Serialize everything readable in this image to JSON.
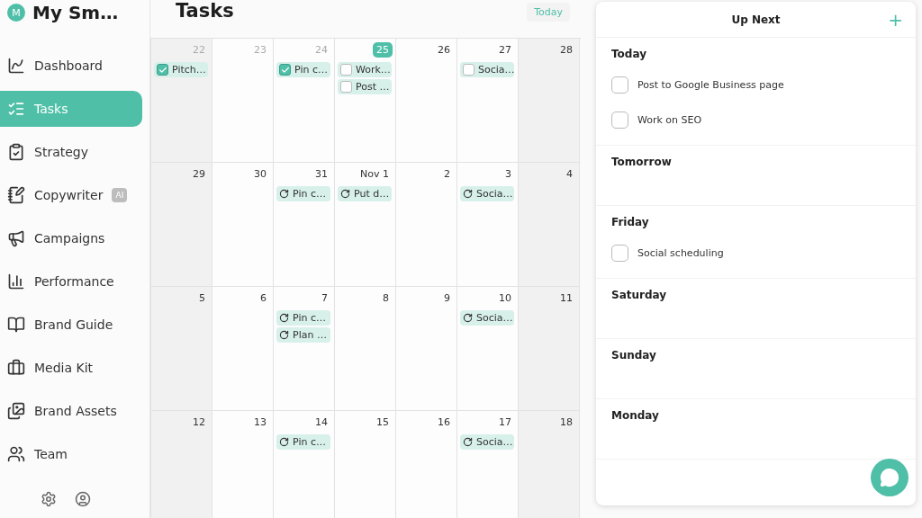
{
  "app": {
    "logo_letter": "M",
    "name": "My Sm…"
  },
  "sidebar": {
    "items": [
      {
        "label": "Dashboard",
        "selected": false
      },
      {
        "label": "Tasks",
        "selected": true
      },
      {
        "label": "Strategy",
        "selected": false
      },
      {
        "label": "Copywriter",
        "selected": false,
        "badge": "AI"
      },
      {
        "label": "Campaigns",
        "selected": false
      },
      {
        "label": "Performance",
        "selected": false
      },
      {
        "label": "Brand Guide",
        "selected": false
      },
      {
        "label": "Media Kit",
        "selected": false
      },
      {
        "label": "Brand Assets",
        "selected": false
      },
      {
        "label": "Team",
        "selected": false
      }
    ]
  },
  "header": {
    "title": "Tasks",
    "today_button": "Today"
  },
  "calendar": {
    "weeks": [
      {
        "days": [
          {
            "label": "22",
            "muted": true,
            "today": false,
            "tasks": [
              {
                "kind": "check",
                "text": "Pitch…",
                "checked": true
              }
            ]
          },
          {
            "label": "23",
            "muted": true,
            "today": false
          },
          {
            "label": "24",
            "muted": true,
            "today": false,
            "tasks": [
              {
                "kind": "check",
                "text": "Pin c…",
                "checked": true
              }
            ]
          },
          {
            "label": "25",
            "muted": false,
            "today": true,
            "tasks": [
              {
                "kind": "check",
                "text": "Work…",
                "checked": false
              },
              {
                "kind": "check",
                "text": "Post …",
                "checked": false
              }
            ]
          },
          {
            "label": "26",
            "muted": false,
            "today": false
          },
          {
            "label": "27",
            "muted": false,
            "today": false,
            "tasks": [
              {
                "kind": "check",
                "text": "Socia…",
                "checked": false
              }
            ]
          },
          {
            "label": "28",
            "muted": false,
            "today": false
          }
        ]
      },
      {
        "days": [
          {
            "label": "29",
            "muted": false,
            "today": false
          },
          {
            "label": "30",
            "muted": false,
            "today": false
          },
          {
            "label": "31",
            "muted": false,
            "today": false,
            "tasks": [
              {
                "kind": "recurring",
                "text": "Pin c…"
              }
            ]
          },
          {
            "label": "Nov 1",
            "muted": false,
            "today": false,
            "tasks": [
              {
                "kind": "recurring",
                "text": "Put d…"
              }
            ]
          },
          {
            "label": "2",
            "muted": false,
            "today": false
          },
          {
            "label": "3",
            "muted": false,
            "today": false,
            "tasks": [
              {
                "kind": "recurring",
                "text": "Socia…"
              }
            ]
          },
          {
            "label": "4",
            "muted": false,
            "today": false
          }
        ]
      },
      {
        "days": [
          {
            "label": "5",
            "muted": false,
            "today": false
          },
          {
            "label": "6",
            "muted": false,
            "today": false
          },
          {
            "label": "7",
            "muted": false,
            "today": false,
            "tasks": [
              {
                "kind": "recurring",
                "text": "Pin c…"
              },
              {
                "kind": "recurring",
                "text": "Plan …"
              }
            ]
          },
          {
            "label": "8",
            "muted": false,
            "today": false
          },
          {
            "label": "9",
            "muted": false,
            "today": false
          },
          {
            "label": "10",
            "muted": false,
            "today": false,
            "tasks": [
              {
                "kind": "recurring",
                "text": "Socia…"
              }
            ]
          },
          {
            "label": "11",
            "muted": false,
            "today": false
          }
        ]
      },
      {
        "days": [
          {
            "label": "12",
            "muted": false,
            "today": false
          },
          {
            "label": "13",
            "muted": false,
            "today": false
          },
          {
            "label": "14",
            "muted": false,
            "today": false,
            "tasks": [
              {
                "kind": "recurring",
                "text": "Pin c…"
              }
            ]
          },
          {
            "label": "15",
            "muted": false,
            "today": false
          },
          {
            "label": "16",
            "muted": false,
            "today": false
          },
          {
            "label": "17",
            "muted": false,
            "today": false,
            "tasks": [
              {
                "kind": "recurring",
                "text": "Socia…"
              }
            ]
          },
          {
            "label": "18",
            "muted": false,
            "today": false
          }
        ]
      }
    ]
  },
  "up_next": {
    "title": "Up Next",
    "add": "+",
    "sections": [
      {
        "title": "Today",
        "tasks": [
          {
            "text": "Post to Google Business page",
            "checked": false
          },
          {
            "text": "Work on SEO",
            "checked": false
          }
        ]
      },
      {
        "title": "Tomorrow"
      },
      {
        "title": "Friday",
        "tasks": [
          {
            "text": "Social scheduling",
            "checked": false
          }
        ]
      },
      {
        "title": "Saturday"
      },
      {
        "title": "Sunday"
      },
      {
        "title": "Monday"
      }
    ]
  }
}
